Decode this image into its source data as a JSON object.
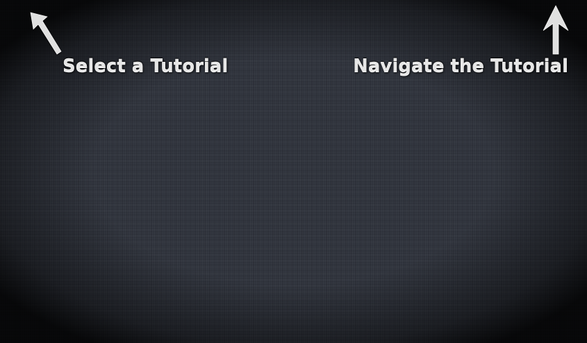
{
  "hints": {
    "select_tutorial": {
      "label": "Select a Tutorial",
      "icon": "arrow-up-left-icon"
    },
    "navigate_tutorial": {
      "label": "Navigate the Tutorial",
      "icon": "arrow-up-icon"
    }
  },
  "colors": {
    "background": "#30343d",
    "label_text": "#e6e6e6",
    "arrow": "#e0e0e0"
  }
}
